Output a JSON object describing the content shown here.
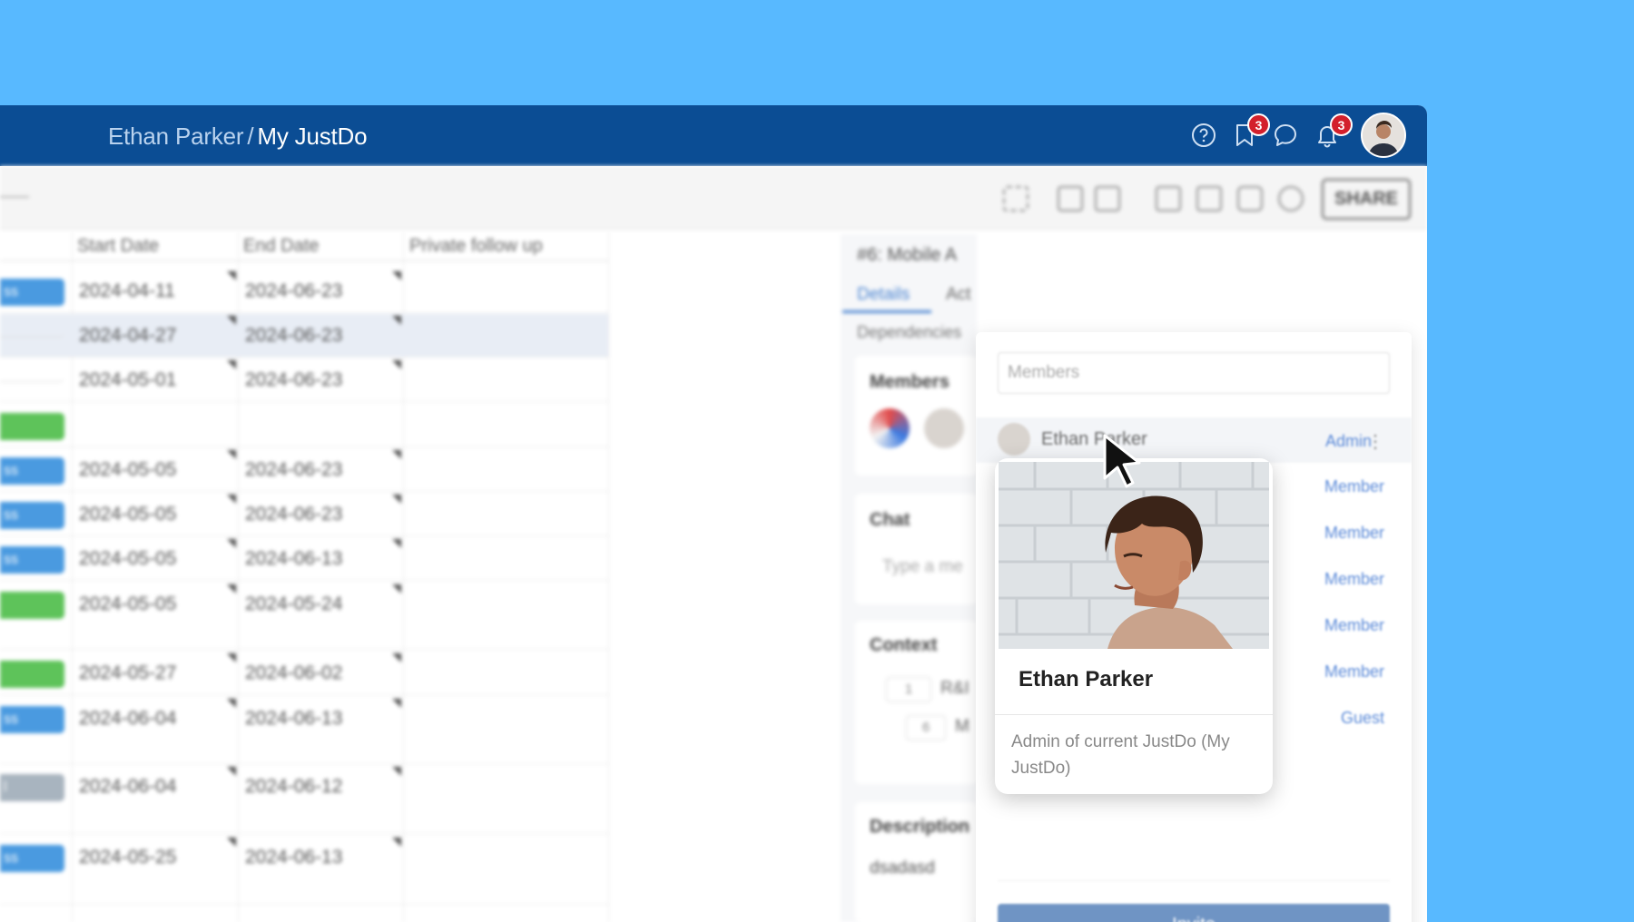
{
  "header": {
    "owner": "Ethan Parker",
    "separator": "/",
    "project": "My JustDo",
    "icons": [
      "help-icon",
      "bookmark-icon",
      "chat-icon",
      "bell-icon"
    ],
    "bookmark_badge": "3",
    "bell_badge": "3"
  },
  "toolbar": {
    "share_label": "SHARE"
  },
  "grid": {
    "columns": [
      "Start Date",
      "End Date",
      "Private follow up"
    ],
    "rows": [
      {
        "status": "ss",
        "status_color": "#4a9ae0",
        "start": "2024-04-11",
        "end": "2024-06-23"
      },
      {
        "status": "",
        "status_color": "",
        "start": "2024-04-27",
        "end": "2024-06-23"
      },
      {
        "status": "",
        "status_color": "",
        "start": "2024-05-01",
        "end": "2024-06-23"
      },
      {
        "status": "",
        "status_color": "#5ec35a",
        "start": "",
        "end": ""
      },
      {
        "status": "ss",
        "status_color": "#4a9ae0",
        "start": "2024-05-05",
        "end": "2024-06-23"
      },
      {
        "status": "ss",
        "status_color": "#4a9ae0",
        "start": "2024-05-05",
        "end": "2024-06-23"
      },
      {
        "status": "ss",
        "status_color": "#4a9ae0",
        "start": "2024-05-05",
        "end": "2024-06-13"
      },
      {
        "status": "",
        "status_color": "#5ec35a",
        "start": "2024-05-05",
        "end": "2024-05-24"
      },
      {
        "status": "",
        "status_color": "#5ec35a",
        "start": "2024-05-27",
        "end": "2024-06-02"
      },
      {
        "status": "ss",
        "status_color": "#4a9ae0",
        "start": "2024-06-04",
        "end": "2024-06-13"
      },
      {
        "status": "l",
        "status_color": "#a8b4bf",
        "start": "2024-06-04",
        "end": "2024-06-12"
      },
      {
        "status": "ss",
        "status_color": "#4a9ae0",
        "start": "2024-05-25",
        "end": "2024-06-13"
      }
    ]
  },
  "detail": {
    "task_title": "#6:  Mobile A",
    "tabs": [
      "Details",
      "Act"
    ],
    "dependencies": "Dependencies",
    "members_label": "Members",
    "chat_label": "Chat",
    "chat_placeholder": "Type a me",
    "context_label": "Context",
    "context_items": [
      {
        "num": "1",
        "label": "R&I"
      },
      {
        "num": "6",
        "label": "M"
      }
    ],
    "description_label": "Description",
    "description_text": "dsadasd"
  },
  "members_dropdown": {
    "placeholder": "Members",
    "first_member": "Ethan Parker",
    "roles": [
      "Admin",
      "Member",
      "Member",
      "Member",
      "Member",
      "Member",
      "Guest"
    ],
    "invite_label": "Invite"
  },
  "profile_popup": {
    "name": "Ethan Parker",
    "role_text": "Admin of current JustDo (My JustDo)"
  },
  "colors": {
    "topbar": "#0b4d94",
    "background": "#58b9ff",
    "badge": "#d3202c",
    "invite": "#6f94c4"
  }
}
